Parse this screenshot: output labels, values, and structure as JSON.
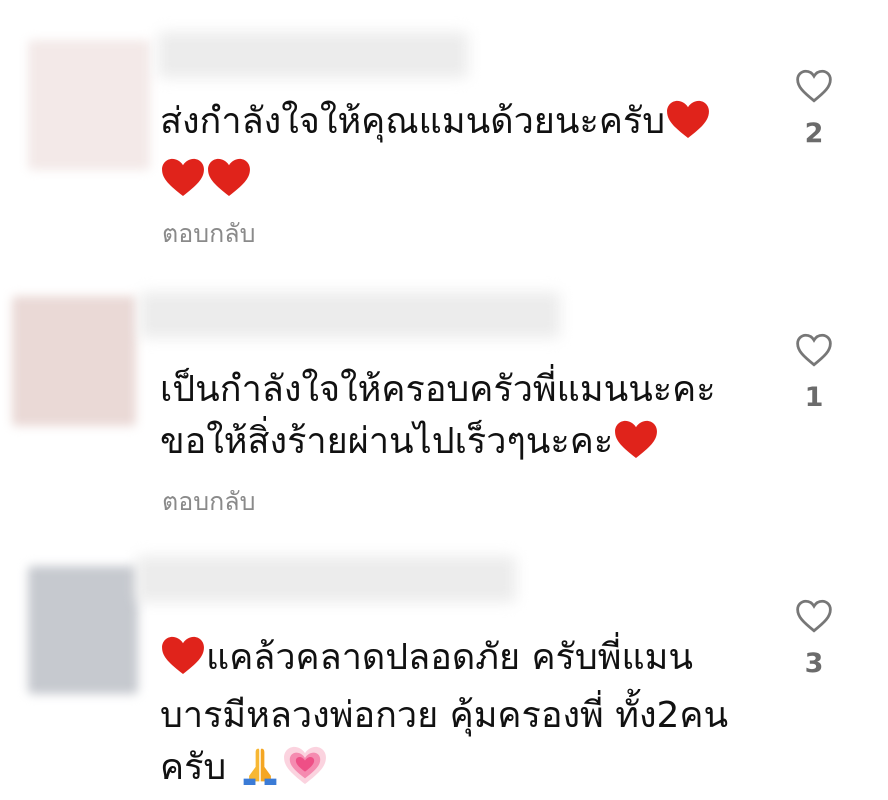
{
  "comments": [
    {
      "lines": [
        "ส่งกำลังใจให้คุณแมนด้วยนะครับ",
        ""
      ],
      "reply_label": "ตอบกลับ",
      "like_count": "2",
      "avatar_color": "#f3e9e8",
      "namebar_color": "#efefef"
    },
    {
      "lines": [
        "เป็นกำลังใจให้ครอบครัวพี่แมนนะคะ",
        "ขอให้สิ่งร้ายผ่านไปเร็วๆนะคะ"
      ],
      "reply_label": "ตอบกลับ",
      "like_count": "1",
      "avatar_color": "#ead9d6",
      "namebar_color": "#eeeeee"
    },
    {
      "lines": [
        "แคล้วคลาดปลอดภัย ครับพี่แมน",
        "บารมีหลวงพ่อกวย คุ้มครองพี่ ทั้ง2คน",
        "ครับ"
      ],
      "like_count": "3",
      "avatar_color": "#c6c9cf",
      "namebar_color": "#eeeeee"
    }
  ],
  "icons": {
    "heart_emoji": "red-heart-icon",
    "like": "heart-outline-icon",
    "pray": "folded-hands-icon",
    "sparkle_heart": "growing-heart-icon"
  },
  "colors": {
    "heart_red": "#e0231b",
    "reply_gray": "#8a8a8a",
    "count_gray": "#6b6b6b",
    "like_outline": "#777777"
  }
}
